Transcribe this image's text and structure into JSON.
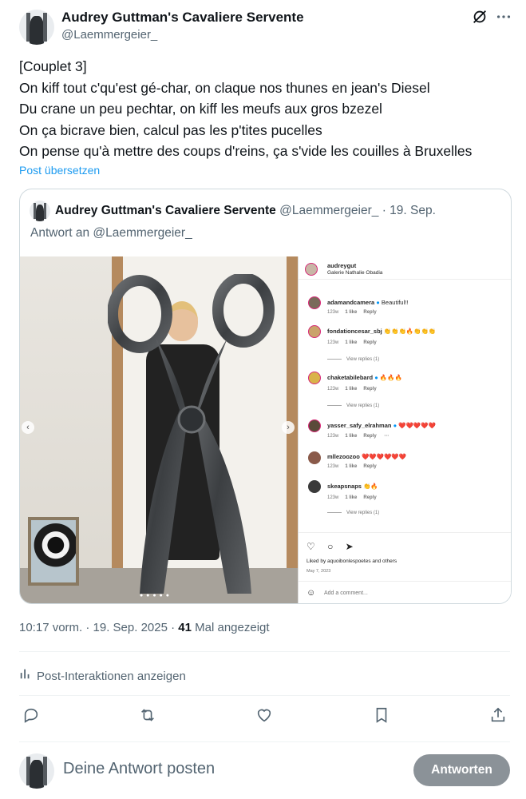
{
  "header": {
    "display_name": "Audrey Guttman's Cavaliere Servente",
    "handle": "@Laemmergeier_",
    "icons": [
      "grok-icon",
      "more-icon"
    ]
  },
  "tweet": {
    "text": "[Couplet 3]\nOn kiff tout c'qu'est gé-char, on claque nos thunes en jean's Diesel\nDu crane un peu pechtar, on kiff les meufs aux gros bzezel\nOn ça bicrave bien, calcul pas les p'tites pucelles\nOn pense qu'à mettre des coups d'reins, ça s'vide les couilles à Bruxelles",
    "translate_label": "Post übersetzen"
  },
  "quote": {
    "display_name": "Audrey Guttman's Cavaliere Servente",
    "handle": "@Laemmergeier_",
    "date": "· 19. Sep.",
    "reply_to": "Antwort an @Laemmergeier_"
  },
  "instagram": {
    "user": "audreygut",
    "location": "Galerie Nathalie Obadia",
    "comments": [
      {
        "user": "adamandcamera",
        "text": "Beautiful!!",
        "age": "123w",
        "likes": "1 like",
        "reply": "Reply",
        "verified": true
      },
      {
        "user": "fondationcesar_sbj",
        "text": "👏👏👏🔥👏👏👏",
        "age": "123w",
        "likes": "1 like",
        "reply": "Reply",
        "replies": "View replies (1)"
      },
      {
        "user": "chaketabilebard",
        "text": "🔥🔥🔥",
        "age": "123w",
        "likes": "1 like",
        "reply": "Reply",
        "verified": true,
        "replies": "View replies (1)"
      },
      {
        "user": "yasser_safy_elrahman",
        "text": "❤️❤️❤️❤️❤️",
        "age": "123w",
        "likes": "1 like",
        "reply": "Reply",
        "verified": true
      },
      {
        "user": "mllezoozoo",
        "text": "❤️❤️❤️❤️❤️❤️",
        "age": "123w",
        "likes": "1 like",
        "reply": "Reply"
      },
      {
        "user": "skeapsnaps",
        "text": "👏🔥",
        "age": "123w",
        "likes": "1 like",
        "reply": "Reply",
        "replies": "View replies (1)"
      }
    ],
    "liked_by": "Liked by aquoibonlespoetes and others",
    "date": "May 7, 2023",
    "add_comment": "Add a comment..."
  },
  "meta": {
    "time": "10:17 vorm. · 19. Sep. 2025 ·",
    "views_count": "41",
    "views_label": "Mal angezeigt",
    "analytics_label": "Post-Interaktionen anzeigen"
  },
  "actions": [
    "reply-icon",
    "repost-icon",
    "like-icon",
    "bookmark-icon",
    "share-icon"
  ],
  "reply_box": {
    "placeholder": "Deine Antwort posten",
    "button": "Antworten"
  }
}
